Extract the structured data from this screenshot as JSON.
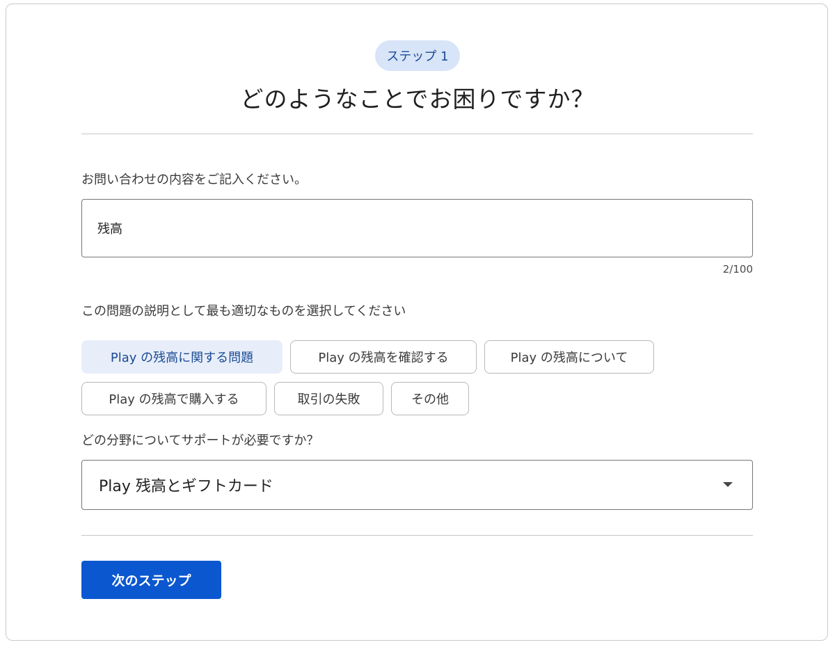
{
  "header": {
    "step_badge": "ステップ 1",
    "title": "どのようなことでお困りですか？"
  },
  "question1": {
    "label": "お問い合わせの内容をご記入ください。",
    "input_value": "残高",
    "char_count": "2/100"
  },
  "question2": {
    "label": "この問題の説明として最も適切なものを選択してください",
    "chips": [
      {
        "label": "Play の残高に関する問題",
        "selected": true
      },
      {
        "label": "Play の残高を確認する",
        "selected": false
      },
      {
        "label": "Play の残高について",
        "selected": false
      },
      {
        "label": "Play の残高で購入する",
        "selected": false
      },
      {
        "label": "取引の失敗",
        "selected": false
      },
      {
        "label": "その他",
        "selected": false
      }
    ]
  },
  "question3": {
    "label": "どの分野についてサポートが必要ですか？",
    "selected_value": "Play 残高とギフトカード",
    "icon": "chevron-down-icon"
  },
  "footer": {
    "next_label": "次のステップ"
  },
  "colors": {
    "primary": "#0b57d0",
    "badge_bg": "#d8e4f8",
    "chip_selected_bg": "#e8eef9",
    "chip_selected_text": "#1a4a94"
  }
}
